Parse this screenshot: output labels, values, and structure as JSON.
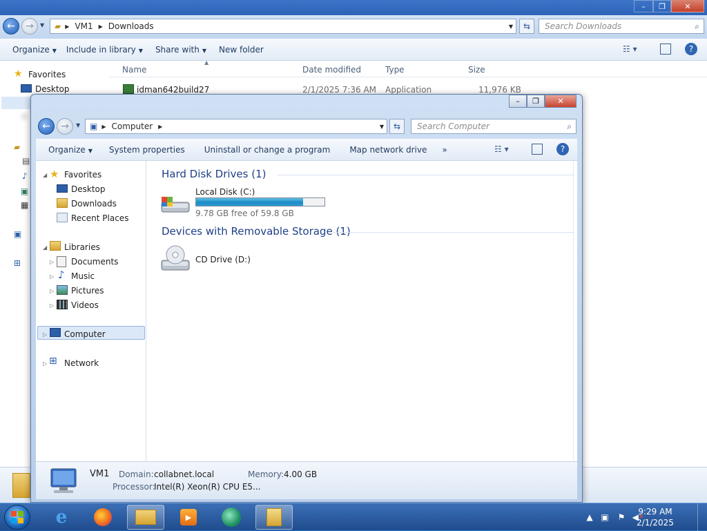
{
  "background_window": {
    "address": [
      "VM1",
      "Downloads"
    ],
    "search_placeholder": "Search Downloads",
    "toolbar": [
      "Organize",
      "Include in library",
      "Share with",
      "New folder"
    ],
    "columns": [
      "Name",
      "Date modified",
      "Type",
      "Size"
    ],
    "nav": {
      "favorites": "Favorites",
      "desktop": "Desktop"
    },
    "rows": [
      {
        "name": "idman642build27",
        "date": "2/1/2025 7:36 AM",
        "type": "Application",
        "size": "11,976 KB"
      }
    ]
  },
  "computer_window": {
    "address": "Computer",
    "search_placeholder": "Search Computer",
    "toolbar": [
      "Organize",
      "System properties",
      "Uninstall or change a program",
      "Map network drive",
      "»"
    ],
    "nav": {
      "favorites": "Favorites",
      "favorites_items": [
        "Desktop",
        "Downloads",
        "Recent Places"
      ],
      "libraries": "Libraries",
      "libraries_items": [
        "Documents",
        "Music",
        "Pictures",
        "Videos"
      ],
      "computer": "Computer",
      "network": "Network"
    },
    "groups": {
      "hard_disk": "Hard Disk Drives (1)",
      "removable": "Devices with Removable Storage (1)"
    },
    "drives": {
      "local_disk": {
        "label": "Local Disk (C:)",
        "free": "9.78 GB free of 59.8 GB",
        "used_fraction": 0.836
      },
      "cd_drive": {
        "label": "CD Drive (D:)"
      }
    },
    "details": {
      "name": "VM1",
      "domain_label": "Domain:",
      "domain": "collabnet.local",
      "memory_label": "Memory:",
      "memory": "4.00 GB",
      "processor_label": "Processor:",
      "processor": "Intel(R) Xeon(R) CPU E5..."
    }
  },
  "taskbar": {
    "time": "9:29 AM",
    "date": "2/1/2025"
  }
}
